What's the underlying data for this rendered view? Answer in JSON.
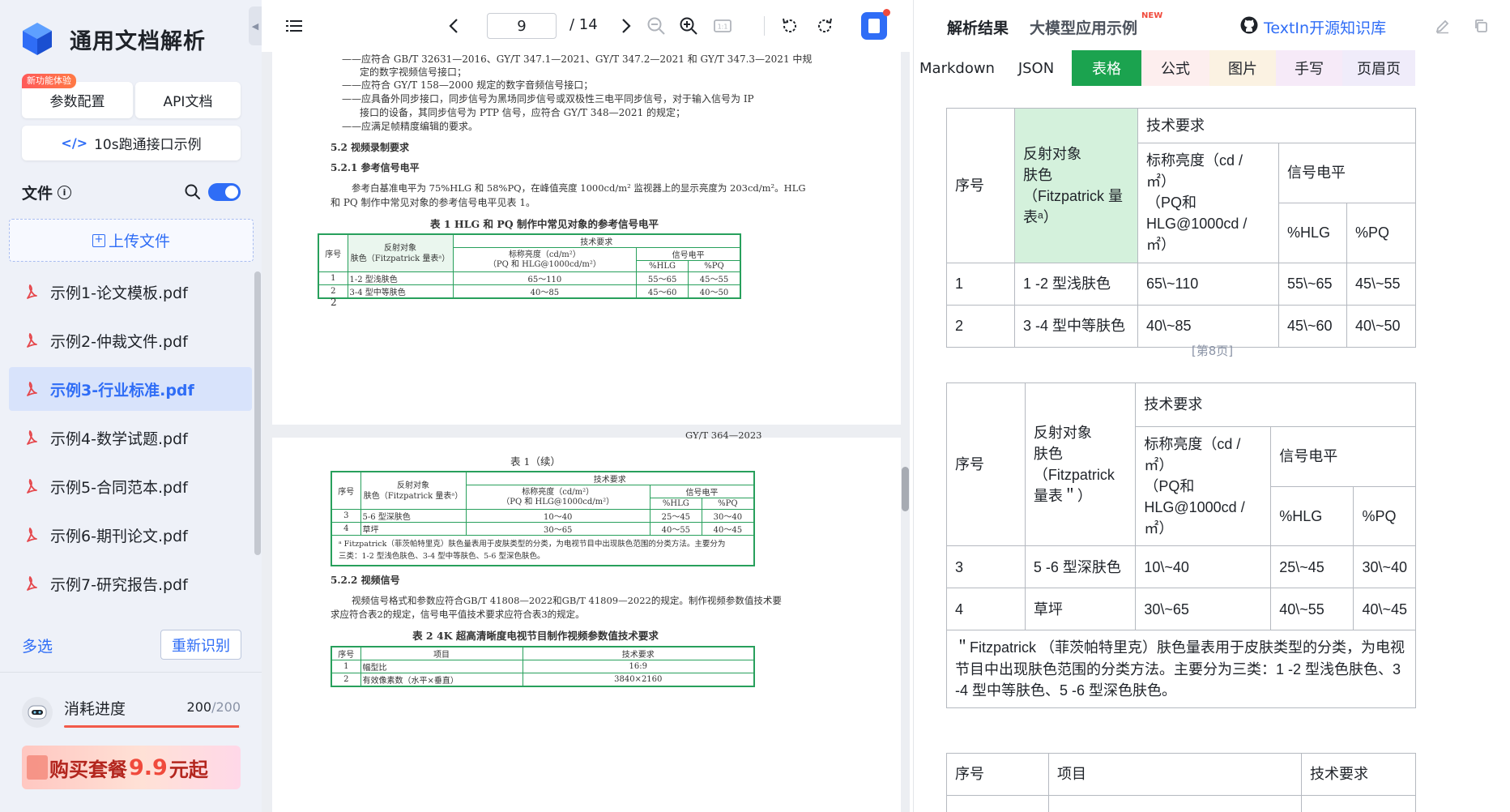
{
  "sidebar": {
    "app_title": "通用文档解析",
    "new_badge": "新功能体验",
    "params_button": "参数配置",
    "api_button": "API文档",
    "demo_button": "10s跑通接口示例",
    "demo_glyph": "</>",
    "files_label": "文件",
    "upload_label": "上传文件",
    "files": [
      {
        "name": "示例1-论文模板.pdf",
        "active": false
      },
      {
        "name": "示例2-仲裁文件.pdf",
        "active": false
      },
      {
        "name": "示例3-行业标准.pdf",
        "active": true
      },
      {
        "name": "示例4-数学试题.pdf",
        "active": false
      },
      {
        "name": "示例5-合同范本.pdf",
        "active": false
      },
      {
        "name": "示例6-期刊论文.pdf",
        "active": false
      },
      {
        "name": "示例7-研究报告.pdf",
        "active": false
      }
    ],
    "multi_select": "多选",
    "reidentify_button": "重新识别",
    "progress_label": "消耗进度",
    "progress_used": "200",
    "progress_total": "/200",
    "progress_fraction": 0.99,
    "buy_prefix": "购买套餐",
    "buy_price": "9.9",
    "buy_suffix": "元起"
  },
  "viewer": {
    "current_page": "9",
    "total_pages": "/ 14",
    "page1": {
      "lines": [
        "——应符合 GB/T 32631—2016、GY/T 347.1—2021、GY/T 347.2—2021 和 GY/T 347.3—2021 中规",
        "定的数字视频信号接口；",
        "——应符合 GY/T 158—2000 规定的数字音频信号接口；",
        "——应具备外同步接口，同步信号为黑场同步信号或双极性三电平同步信号，对于输入信号为 IP",
        "接口的设备，其同步信号为 PTP 信号，应符合 GY/T 348—2021 的规定；",
        "——应满足帧精度编辑的要求。",
        "5.2  视频录制要求",
        "5.2.1  参考信号电平",
        "参考白基准电平为 75%HLG 和 58%PQ，在峰值亮度 1000cd/m² 监视器上的显示亮度为 203cd/m²。HLG",
        "和 PQ 制作中常见对象的参考信号电平见表 1。"
      ],
      "table_caption": "表 1  HLG 和 PQ 制作中常见对象的参考信号电平",
      "table": {
        "h_seq": "序号",
        "h_obj": "反射对象",
        "h_obj2": "肤色（Fitzpatrick 量表ᵃ）",
        "h_tech": "技术要求",
        "h_lum": "标称亮度（cd/m²）",
        "h_lum2": "（PQ 和 HLG@1000cd/m²）",
        "h_sig": "信号电平",
        "h_hlg": "%HLG",
        "h_pq": "%PQ",
        "rows": [
          [
            "1",
            "1-2 型浅肤色",
            "65～110",
            "55～65",
            "45～55"
          ],
          [
            "2",
            "3-4 型中等肤色",
            "40～85",
            "45～60",
            "40～50"
          ]
        ]
      },
      "page_number": "2"
    },
    "page2": {
      "running_header": "GY/T 364—2023",
      "table_caption": "表 1（续）",
      "table": {
        "rows": [
          [
            "3",
            "5-6 型深肤色",
            "10～40",
            "25～45",
            "30～40"
          ],
          [
            "4",
            "草坪",
            "30～65",
            "40～55",
            "40～45"
          ]
        ],
        "footnote1": "ᵃ Fitzpatrick（菲茨帕特里克）肤色量表用于皮肤类型的分类，为电视节目中出现肤色范围的分类方法。主要分为",
        "footnote2": "三类：1-2 型浅色肤色、3-4 型中等肤色、5-6 型深色肤色。"
      },
      "section": "5.2.2  视频信号",
      "para1": "视频信号格式和参数应符合GB/T 41808—2022和GB/T 41809—2022的规定。制作视频参数值技术要",
      "para2": "求应符合表2的规定，信号电平值技术要求应符合表3的规定。",
      "table2_caption": "表 2  4K 超高清晰度电视节目制作视频参数值技术要求",
      "table2": {
        "h_seq": "序号",
        "h_item": "项目",
        "h_req": "技术要求",
        "rows": [
          [
            "1",
            "幅型比",
            "16:9"
          ],
          [
            "2",
            "有效像素数（水平×垂直）",
            "3840×2160"
          ]
        ]
      }
    }
  },
  "results": {
    "title": "解析结果",
    "llm_tab": "大模型应用示例",
    "new_tag": "NEW",
    "github_link": "TextIn开源知识库",
    "tabs": [
      {
        "label": "Markdown",
        "color": "#ffffff",
        "width": 107
      },
      {
        "label": "JSON",
        "color": "#ffffff",
        "width": 88
      },
      {
        "label": "表格",
        "color": "#1ba34f",
        "width": 86,
        "active": true
      },
      {
        "label": "公式",
        "color": "#fdeeee",
        "width": 84
      },
      {
        "label": "图片",
        "color": "#fbf2e2",
        "width": 82
      },
      {
        "label": "手写",
        "color": "#f6eaf8",
        "width": 82
      },
      {
        "label": "页眉页",
        "color": "#f0ecfa",
        "width": 90
      }
    ],
    "table1": {
      "h_seq": "序号",
      "h_obj": "反射对象\n肤色（Fitzpatrick 量表ᵃ）",
      "h_tech": "技术要求",
      "h_lum": "标称亮度（cd / ㎡）\n（PQ和 HLG@1000cd / ㎡）",
      "h_sig": "信号电平",
      "h_hlg": "%HLG",
      "h_pq": "%PQ",
      "rows": [
        [
          "1",
          "1 -2 型浅肤色",
          "65\\~110",
          "55\\~65",
          "45\\~55"
        ],
        [
          "2",
          "3 -4 型中等肤色",
          "40\\~85",
          "45\\~60",
          "40\\~50"
        ]
      ]
    },
    "page_marker": "[第8页]",
    "table2": {
      "h_seq": "序号",
      "h_obj": "反射对象\n肤色（Fitzpatrick 量表＂）",
      "h_tech": "技术要求",
      "h_lum": "标称亮度（cd / ㎡）\n（PQ和 HLG@1000cd / ㎡）",
      "h_sig": "信号电平",
      "h_hlg": "%HLG",
      "h_pq": "%PQ",
      "rows": [
        [
          "3",
          "5 -6 型深肤色",
          "10\\~40",
          "25\\~45",
          "30\\~40"
        ],
        [
          "4",
          "草坪",
          "30\\~65",
          "40\\~55",
          "40\\~45"
        ]
      ],
      "footnote": "＂Fitzpatrick （菲茨帕特里克）肤色量表用于皮肤类型的分类，为电视节目中出现肤色范围的分类方法。主要分为三类：1 -2 型浅色肤色、3 -4 型中等肤色、5 -6 型深色肤色。"
    },
    "table3": {
      "h_seq": "序号",
      "h_item": "项目",
      "h_req": "技术要求"
    }
  },
  "colors": {
    "accent": "#2f6df6",
    "table_green": "#1ba34f",
    "header_green": "#d4f1dc",
    "sidebar_bg": "#eef1f8"
  }
}
